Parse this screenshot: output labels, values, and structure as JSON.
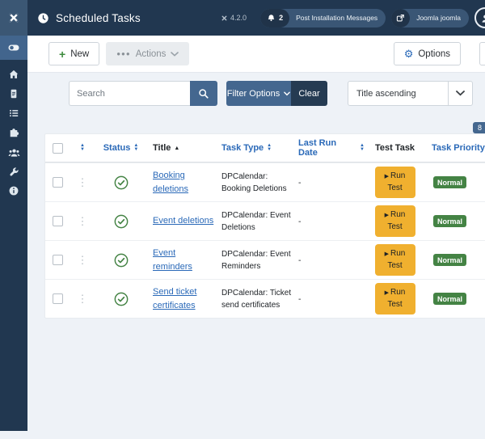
{
  "header": {
    "app_title": "Scheduled Tasks",
    "version": "4.2.0",
    "post_installation": {
      "count": "2",
      "label": "Post Installation Messages"
    },
    "user_label": "Joomla joomla"
  },
  "toolbar": {
    "new": "New",
    "actions": "Actions",
    "options": "Options"
  },
  "filters": {
    "search_placeholder": "Search",
    "filter_options": "Filter Options",
    "clear": "Clear",
    "sort_selected": "Title ascending",
    "corner_badge": "8"
  },
  "table": {
    "headers": {
      "status": "Status",
      "title": "Title",
      "task_type": "Task Type",
      "last_run_date": "Last Run Date",
      "test_task": "Test Task",
      "task_priority": "Task Priority"
    },
    "rows": [
      {
        "title": "Booking deletions",
        "task_type": "DPCalendar: Booking Deletions",
        "last_run_date": "-",
        "test_button": "Run Test",
        "priority": "Normal"
      },
      {
        "title": "Event deletions",
        "task_type": "DPCalendar: Event Deletions",
        "last_run_date": "-",
        "test_button": "Run Test",
        "priority": "Normal"
      },
      {
        "title": "Event reminders",
        "task_type": "DPCalendar: Event Reminders",
        "last_run_date": "-",
        "test_button": "Run Test",
        "priority": "Normal"
      },
      {
        "title": "Send ticket certificates",
        "task_type": "DPCalendar: Ticket send certificates",
        "last_run_date": "-",
        "test_button": "Run Test",
        "priority": "Normal"
      }
    ]
  },
  "colors": {
    "header_navy": "#213750",
    "steel_blue": "#44678f",
    "accent_blue": "#2a69b8",
    "success_green": "#448344",
    "warning_amber": "#f0b02f",
    "content_bg": "#eef2f7"
  }
}
